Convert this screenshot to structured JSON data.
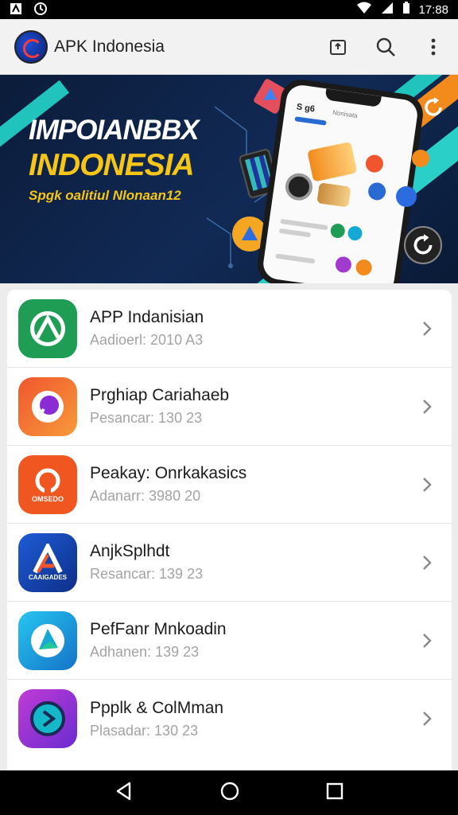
{
  "status_bar": {
    "time": "17:88",
    "icons": [
      "notification-icon",
      "sync-icon",
      "wifi-icon",
      "signal-icon",
      "battery-icon"
    ]
  },
  "app_bar": {
    "title": "APK Indonesia",
    "actions": [
      "share-icon",
      "search-icon",
      "more-vert-icon"
    ]
  },
  "banner": {
    "line1": "IMPOIANBBX",
    "line2": "INDONESIA",
    "line3": "Spgk oalitiul Nlonaan12",
    "phone_header": "S g6",
    "phone_tab": "Nonisata"
  },
  "apps": [
    {
      "name": "APP Indanisian",
      "meta": "Aadioerl: 2010 A3",
      "icon": "android-green-icon",
      "color": "#1f9d55"
    },
    {
      "name": "Prghiap Cariahaeb",
      "meta": "Pesancar: 130 23",
      "icon": "chat-orange-icon",
      "color": "#f0562e"
    },
    {
      "name": "Peakay: Onrkakasics",
      "meta": "Adanarr: 3980 20",
      "icon": "circle-orange-icon",
      "color": "#f0561f",
      "icon_label": "OMSEDO"
    },
    {
      "name": "AnjkSplhdt",
      "meta": "Resancar: 139 23",
      "icon": "a-logo-blue-icon",
      "color": "#1e5bd6",
      "icon_label": "CAAIGADES"
    },
    {
      "name": "PefFanr Mnkoadin",
      "meta": "Adhanen: 139 23",
      "icon": "play-teal-icon",
      "color": "#17a9d6"
    },
    {
      "name": "Ppplk & ColMman",
      "meta": "Plasadar: 130 23",
      "icon": "play-purple-icon",
      "color": "#a13bd0"
    }
  ],
  "nav_bar": {
    "buttons": [
      "back-icon",
      "home-icon",
      "recents-icon"
    ]
  }
}
